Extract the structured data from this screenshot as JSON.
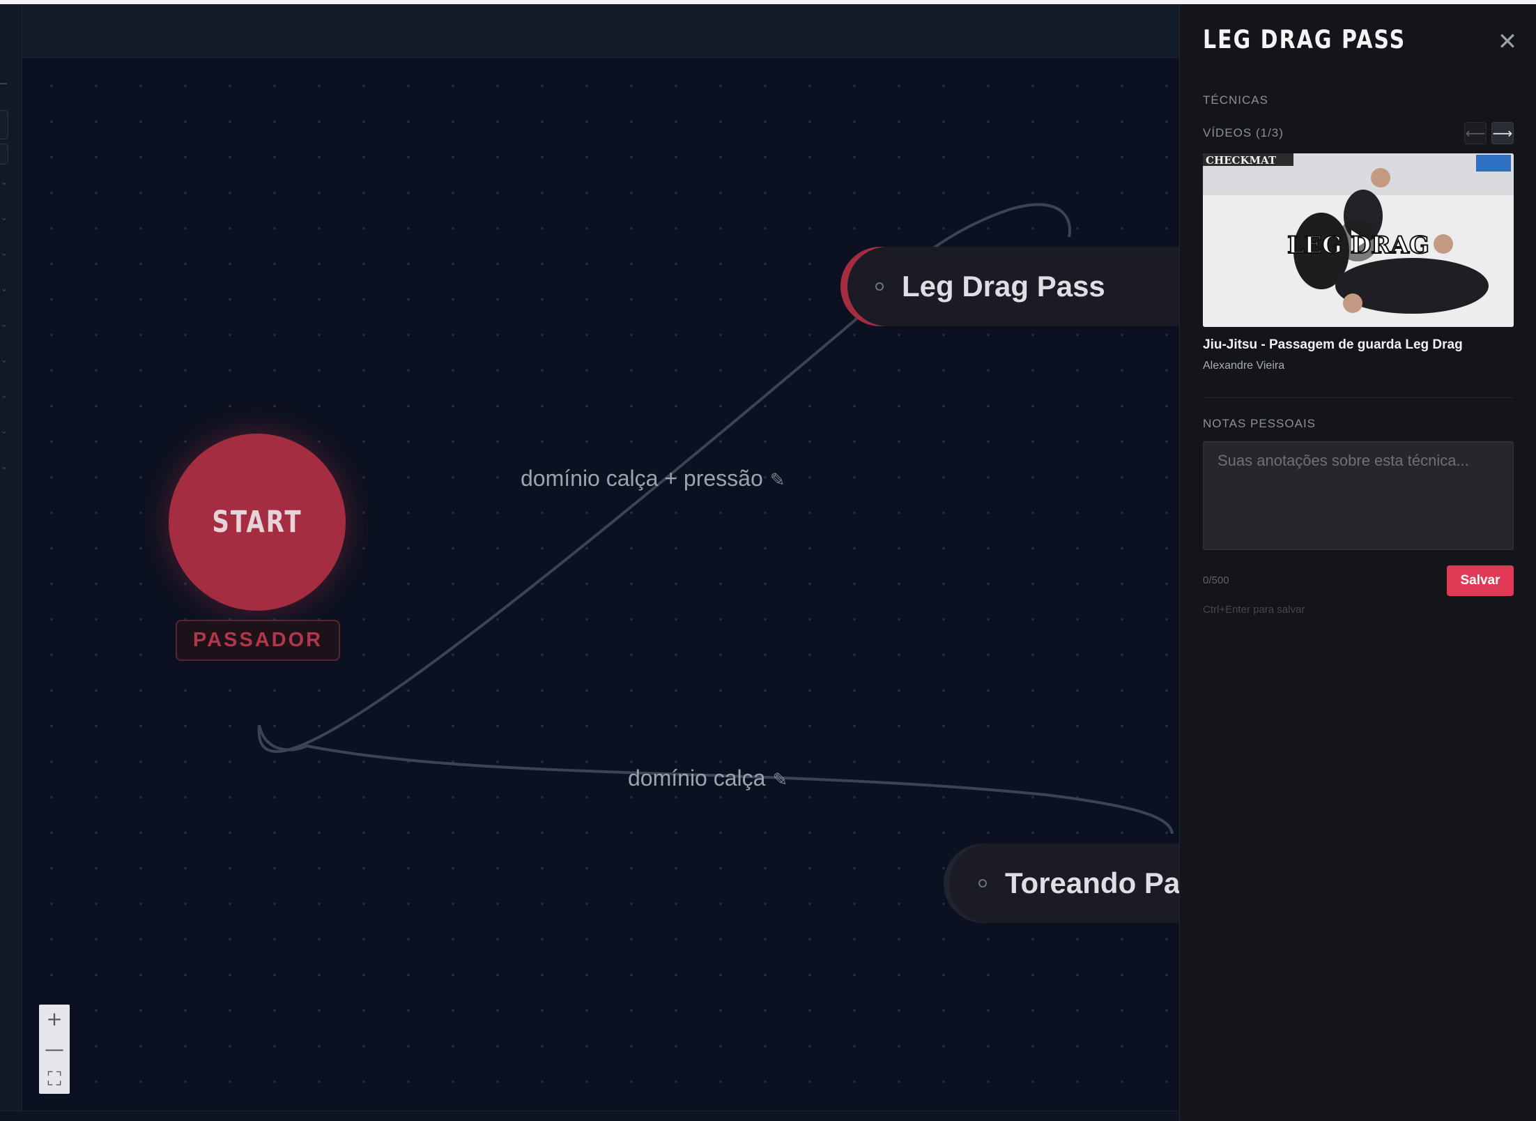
{
  "colors": {
    "accent": "#a52d42",
    "save_button": "#e03a56",
    "canvas_bg": "#0b1120",
    "panel_bg": "#141519"
  },
  "graph": {
    "start_node": {
      "label": "START"
    },
    "role_badge": "PASSADOR",
    "nodes": [
      {
        "label": "Leg Drag Pass"
      },
      {
        "label": "Toreando Pa"
      }
    ],
    "edges": [
      {
        "label": "domínio calça + pressão",
        "edit_icon": "pencil-icon"
      },
      {
        "label": "domínio calça",
        "edit_icon": "pencil-icon"
      }
    ]
  },
  "zoom_controls": {
    "zoom_in": "+",
    "zoom_out": "—",
    "fit": "⛶"
  },
  "panel": {
    "title": "LEG DRAG PASS",
    "close_icon": "close-icon",
    "section_techniques": "TÉCNICAS",
    "videos_label": "VÍDEOS (1/3)",
    "prev_icon": "arrow-left-icon",
    "next_icon": "arrow-right-icon",
    "video": {
      "thumbnail_text": "LEG DRAG",
      "thumbnail_brand": "CHECKMAT",
      "title": "Jiu-Jitsu - Passagem de guarda Leg Drag",
      "author": "Alexandre Vieira"
    },
    "notes_label": "NOTAS PESSOAIS",
    "notes_placeholder": "Suas anotações sobre esta técnica...",
    "char_count": "0/500",
    "save_label": "Salvar",
    "save_hint": "Ctrl+Enter para salvar"
  }
}
